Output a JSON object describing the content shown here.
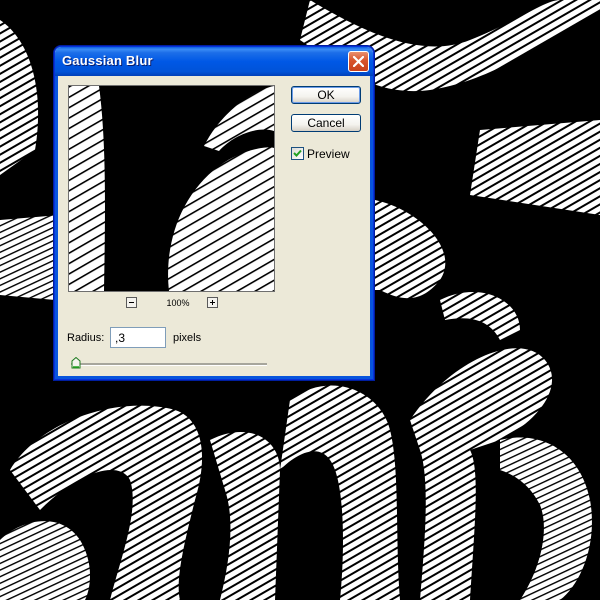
{
  "dialog": {
    "title": "Gaussian Blur",
    "close_icon": "close-icon",
    "ok_label": "OK",
    "cancel_label": "Cancel",
    "preview_label": "Preview",
    "preview_checked": true,
    "zoom": {
      "level_label": "100%",
      "minus_icon": "zoom-out-icon",
      "plus_icon": "zoom-in-icon"
    },
    "radius": {
      "label": "Radius:",
      "value": ",3",
      "units": "pixels",
      "slider_fraction": 0.0
    }
  },
  "colors": {
    "titlebar": "#0058e6",
    "dialog_bg": "#ece9d8",
    "close": "#d8542c",
    "canvas_bg": "#000000",
    "artwork": "#ffffff",
    "checkmark": "#21a121"
  }
}
